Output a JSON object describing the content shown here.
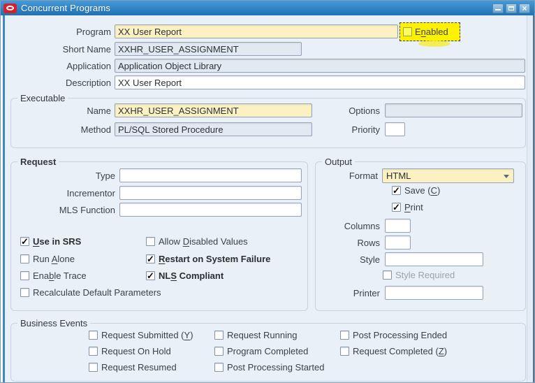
{
  "window": {
    "title": "Concurrent Programs",
    "close_glyph": "×"
  },
  "colors": {
    "titlebar_blue": "#2A7FC1",
    "oracle_red": "#D6202B",
    "required_field_bg": "#FBF1C2",
    "readonly_field_bg": "#E3E9F1",
    "highlight_yellow": "#FFF200",
    "content_bg": "#EAF0F8"
  },
  "header_fields": {
    "program": {
      "label": "Program",
      "value": "XX User Report"
    },
    "enabled": {
      "pre": "E",
      "key": "n",
      "post": "abled",
      "checked": false
    },
    "short_name": {
      "label": "Short Name",
      "value": "XXHR_USER_ASSIGNMENT"
    },
    "application": {
      "label": "Application",
      "value": "Application Object Library"
    },
    "description": {
      "label": "Description",
      "value": "XX User Report"
    }
  },
  "executable": {
    "title": "Executable",
    "name": {
      "label": "Name",
      "value": "XXHR_USER_ASSIGNMENT"
    },
    "method": {
      "label": "Method",
      "value": "PL/SQL Stored Procedure"
    },
    "options": {
      "label": "Options",
      "value": ""
    },
    "priority": {
      "label": "Priority",
      "value": ""
    }
  },
  "request": {
    "title": "Request",
    "type": {
      "label": "Type",
      "value": ""
    },
    "incrementor": {
      "label": "Incrementor",
      "value": ""
    },
    "mls_function": {
      "label": "MLS Function",
      "value": ""
    },
    "checkboxes_left": [
      {
        "pre": "",
        "key": "U",
        "post": "se in SRS",
        "checked": true
      },
      {
        "pre": "Run ",
        "key": "A",
        "post": "lone",
        "checked": false
      },
      {
        "pre": "Ena",
        "key": "b",
        "post": "le Trace",
        "checked": false
      },
      {
        "pre": "Recalculate Default Parameters",
        "key": "",
        "post": "",
        "checked": false
      }
    ],
    "checkboxes_right": [
      {
        "pre": "Allow ",
        "key": "D",
        "post": "isabled Values",
        "checked": false
      },
      {
        "pre": "",
        "key": "R",
        "post": "estart on System Failure",
        "checked": true
      },
      {
        "pre": "NL",
        "key": "S",
        "post": " Compliant",
        "checked": true
      }
    ]
  },
  "output": {
    "title": "Output",
    "format": {
      "label": "Format",
      "value": "HTML"
    },
    "save": {
      "pre": "Save (",
      "key": "C",
      "post": ")",
      "checked": true
    },
    "print": {
      "pre": "",
      "key": "P",
      "post": "rint",
      "checked": true
    },
    "columns": {
      "label": "Columns",
      "value": ""
    },
    "rows": {
      "label": "Rows",
      "value": ""
    },
    "style": {
      "label": "Style",
      "value": ""
    },
    "style_required": {
      "pre": "Style Required",
      "key": "",
      "post": "",
      "checked": false
    },
    "printer": {
      "label": "Printer",
      "value": ""
    }
  },
  "business_events": {
    "title": "Business Events",
    "columns": [
      [
        {
          "pre": "Request Submitted (",
          "key": "Y",
          "post": ")",
          "checked": false
        },
        {
          "pre": "Request On Hold",
          "key": "",
          "post": "",
          "checked": false
        },
        {
          "pre": "Request Resumed",
          "key": "",
          "post": "",
          "checked": false
        }
      ],
      [
        {
          "pre": "Request Running",
          "key": "",
          "post": "",
          "checked": false
        },
        {
          "pre": "Program Completed",
          "key": "",
          "post": "",
          "checked": false
        },
        {
          "pre": "Post Processing Started",
          "key": "",
          "post": "",
          "checked": false
        }
      ],
      [
        {
          "pre": "Post Processing Ended",
          "key": "",
          "post": "",
          "checked": false
        },
        {
          "pre": "Request Completed (",
          "key": "Z",
          "post": ")",
          "checked": false
        }
      ]
    ]
  }
}
